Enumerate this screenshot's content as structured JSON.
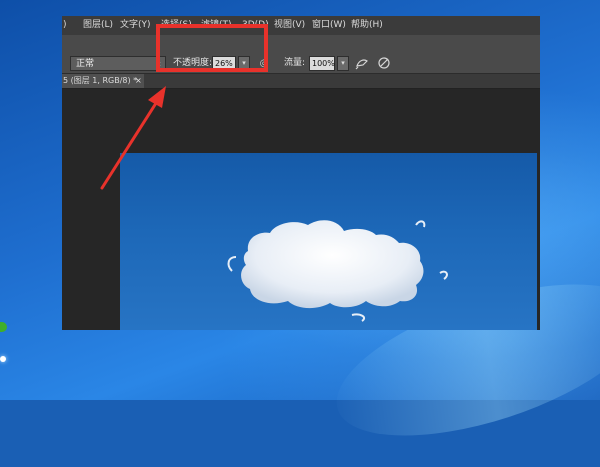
{
  "menubar": {
    "items": [
      {
        "label": ")"
      },
      {
        "label": "图层(L)"
      },
      {
        "label": "文字(Y)"
      },
      {
        "label": "选择(S)"
      },
      {
        "label": "滤镜(T)"
      },
      {
        "label": "3D(D)"
      },
      {
        "label": "视图(V)"
      },
      {
        "label": "窗口(W)"
      },
      {
        "label": "帮助(H)"
      }
    ]
  },
  "options": {
    "blend_mode": "正常",
    "opacity_label": "不透明度:",
    "opacity_value": "26%",
    "flow_label": "流量:",
    "flow_value": "100%"
  },
  "document_tab": {
    "title": "5 (图层 1, RGB/8) *",
    "close": "×"
  },
  "icons": {
    "pressure_opacity": "pressure-opacity-icon",
    "airbrush": "airbrush-icon",
    "pressure_size": "pressure-size-icon"
  },
  "colors": {
    "highlight": "#e8322b",
    "ps_dark": "#282828",
    "options_bar": "#4a4a4a"
  }
}
